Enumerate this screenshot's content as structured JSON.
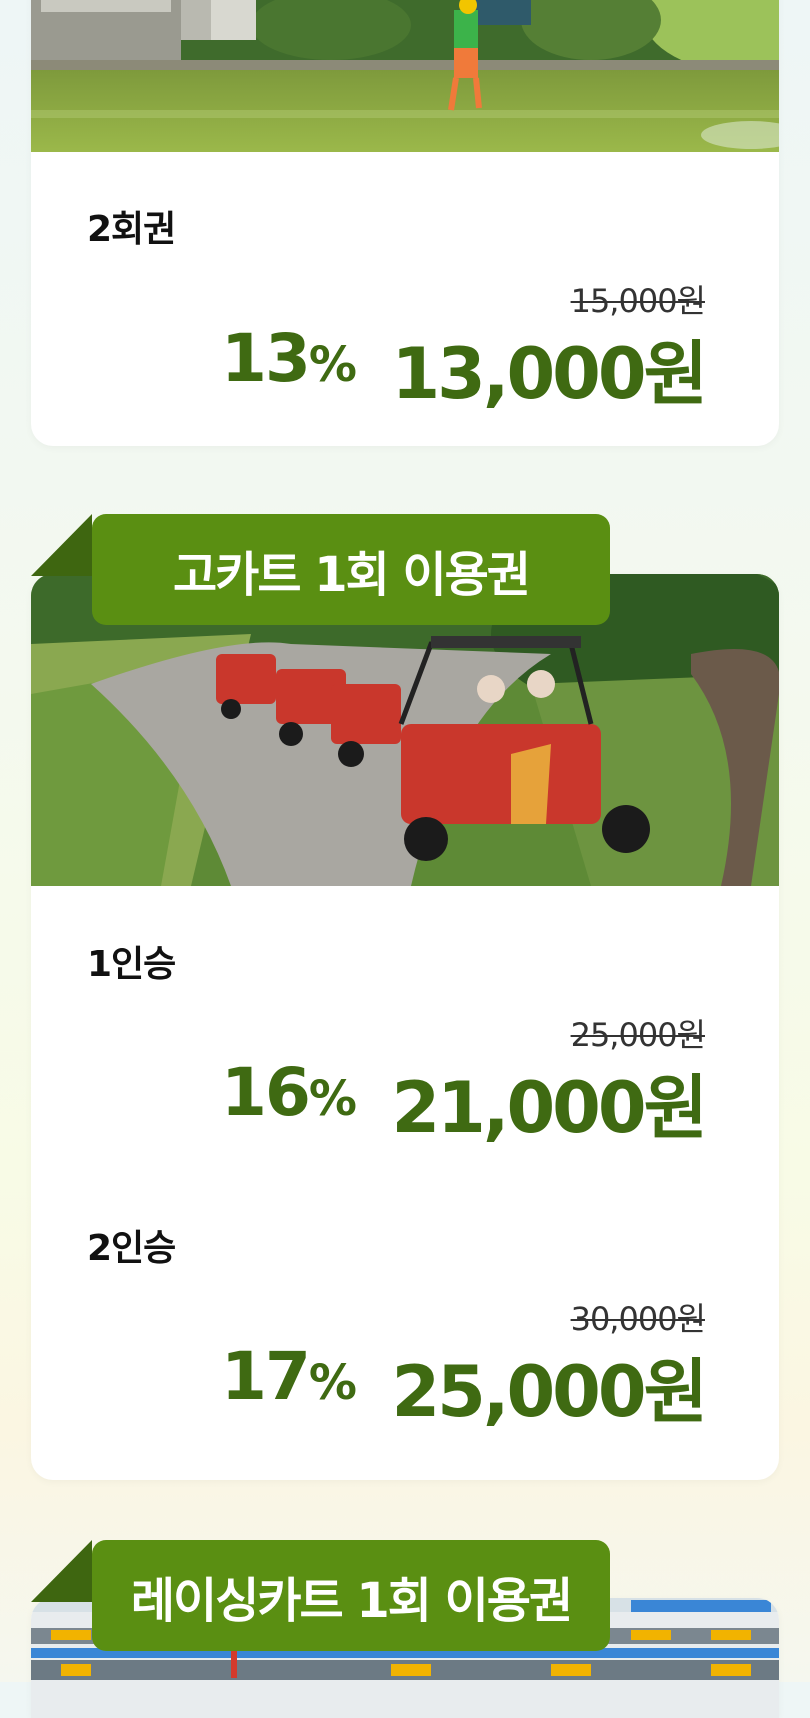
{
  "zipline_section": {
    "options": [
      {
        "name": "2회권",
        "original_price": "15,000원",
        "discount": "13",
        "discount_unit": "%",
        "price": "13,000원"
      }
    ]
  },
  "gokart_section": {
    "title": "고카트 1회 이용권",
    "options": [
      {
        "name": "1인승",
        "original_price": "25,000원",
        "discount": "16",
        "discount_unit": "%",
        "price": "21,000원"
      },
      {
        "name": "2인승",
        "original_price": "30,000원",
        "discount": "17",
        "discount_unit": "%",
        "price": "25,000원"
      }
    ]
  },
  "racing_section": {
    "title": "레이싱카트 1회 이용권"
  },
  "colors": {
    "accent_green": "#5a8f12",
    "price_green": "#3f6a12",
    "ribbon_fold": "#3e6610"
  }
}
